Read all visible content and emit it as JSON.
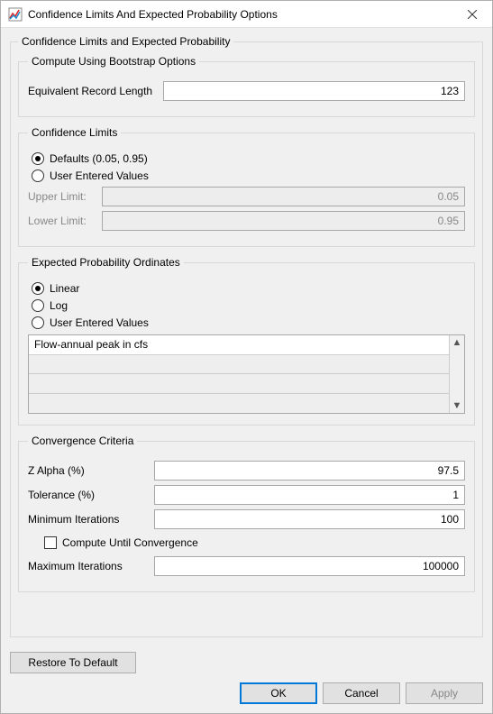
{
  "window": {
    "title": "Confidence Limits And Expected Probability Options"
  },
  "outer": {
    "legend": "Confidence Limits and Expected Probability"
  },
  "bootstrap": {
    "legend": "Compute Using Bootstrap Options",
    "erl_label": "Equivalent Record Length",
    "erl_value": "123"
  },
  "conf_limits": {
    "legend": "Confidence Limits",
    "defaults_label": "Defaults (0.05, 0.95)",
    "user_label": "User Entered Values",
    "upper_label": "Upper Limit:",
    "upper_value": "0.05",
    "lower_label": "Lower Limit:",
    "lower_value": "0.95",
    "selected": "defaults"
  },
  "ordinates": {
    "legend": "Expected Probability Ordinates",
    "linear_label": "Linear",
    "log_label": "Log",
    "user_label": "User Entered Values",
    "selected": "linear",
    "list_item": "Flow-annual peak in cfs"
  },
  "convergence": {
    "legend": "Convergence Criteria",
    "zalpha_label": "Z Alpha (%)",
    "zalpha_value": "97.5",
    "tol_label": "Tolerance (%)",
    "tol_value": "1",
    "miniter_label": "Minimum Iterations",
    "miniter_value": "100",
    "until_label": "Compute Until Convergence",
    "until_checked": false,
    "maxiter_label": "Maximum Iterations",
    "maxiter_value": "100000"
  },
  "buttons": {
    "restore": "Restore To Default",
    "ok": "OK",
    "cancel": "Cancel",
    "apply": "Apply"
  }
}
